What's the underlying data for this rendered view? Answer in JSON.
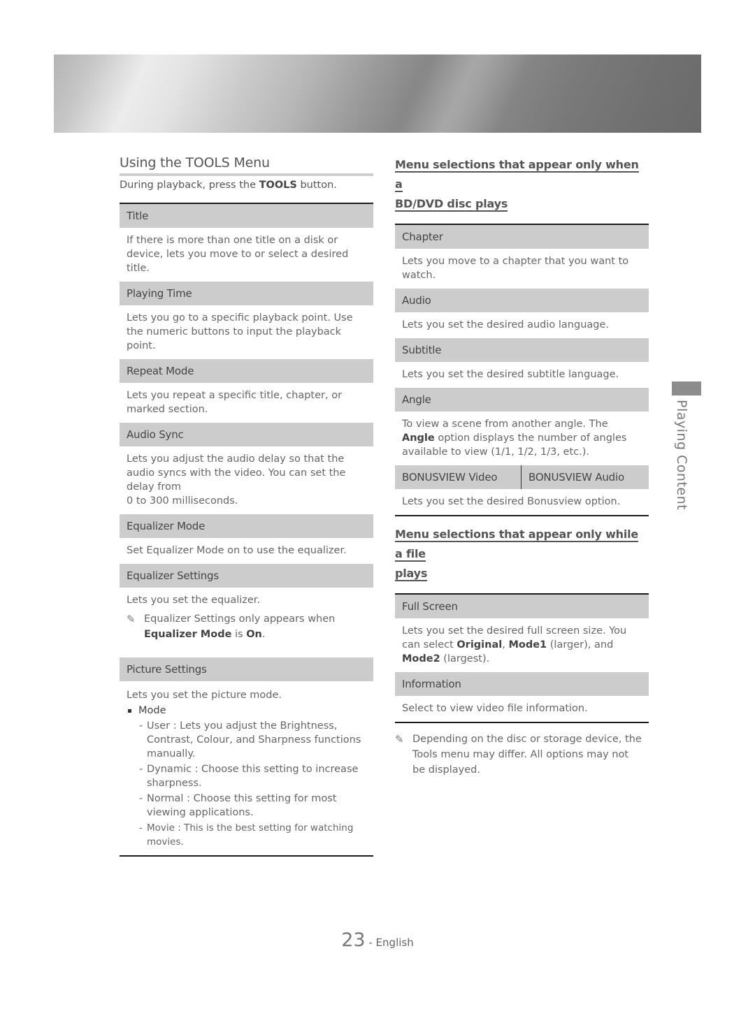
{
  "banner": {
    "icon": "decorative-banner"
  },
  "left": {
    "title": "Using the TOOLS Menu",
    "intro_pre": "During playback, press the ",
    "intro_bold": "TOOLS",
    "intro_post": " button.",
    "rows": [
      {
        "head": "Title",
        "body": "If there is more than one title on a disk or device, lets you move to or select a desired title."
      },
      {
        "head": "Playing Time",
        "body": "Lets you go to a specific playback point. Use the numeric buttons to input the playback point."
      },
      {
        "head": "Repeat Mode",
        "body": "Lets you repeat a specific title, chapter, or marked section."
      },
      {
        "head": "Audio Sync",
        "body": "Lets you adjust the audio delay so that the audio syncs with the video. You can set the delay from",
        "body2": "0 to 300 milliseconds."
      },
      {
        "head": "Equalizer Mode",
        "body": "Set Equalizer Mode on to use the equalizer."
      },
      {
        "head": "Equalizer Settings",
        "body": "Lets you set the equalizer.",
        "note_pre": "Equalizer Settings only appears when ",
        "note_b1": "Equalizer Mode",
        "note_mid": " is ",
        "note_b2": "On",
        "note_post": "."
      },
      {
        "head": "Picture Settings",
        "body": "Lets you set the picture mode.",
        "bullet": "Mode",
        "items": [
          "User : Lets you adjust the Brightness, Contrast, Colour, and Sharpness functions manually.",
          "Dynamic : Choose this setting to increase sharpness.",
          "Normal : Choose this setting for most viewing applications.",
          "Movie : This is the best setting for watching movies."
        ]
      }
    ]
  },
  "right": {
    "disc_heading_1": "Menu selections that appear only when a",
    "disc_heading_2": "BD/DVD disc plays",
    "disc_rows": [
      {
        "head": "Chapter",
        "body": "Lets you move to a chapter that you want to watch."
      },
      {
        "head": "Audio",
        "body": "Lets you set the desired audio language."
      },
      {
        "head": "Subtitle",
        "body": "Lets you set the desired subtitle language."
      },
      {
        "head": "Angle",
        "body_pre": "To view a scene from another angle. The ",
        "body_bold": "Angle",
        "body_post": " option displays the number of angles available to view (1/1, 1/2, 1/3, etc.)."
      },
      {
        "head_a": "BONUSVIEW Video",
        "head_b": "BONUSVIEW Audio",
        "body": "Lets you set the desired Bonusview option."
      }
    ],
    "file_heading_1": "Menu selections that appear only while a file",
    "file_heading_2": "plays",
    "file_rows": [
      {
        "head": "Full Screen",
        "body_pre": "Lets you set the desired full screen size. You can select ",
        "b1": "Original",
        "sep1": ", ",
        "b2": "Mode1",
        "mid": " (larger), and ",
        "b3": "Mode2",
        "post": " (largest)."
      },
      {
        "head": "Information",
        "body": "Select to view video file information."
      }
    ],
    "note": "Depending on the disc or storage device, the Tools menu may differ. All options may not be displayed."
  },
  "side": {
    "label": "Playing Content"
  },
  "footer": {
    "page_number": "23",
    "language": " - English"
  },
  "icons": {
    "note": "✎"
  }
}
